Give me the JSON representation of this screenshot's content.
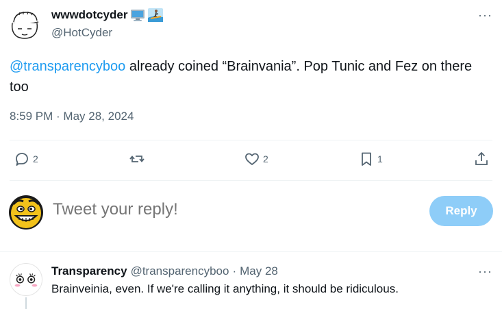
{
  "tweet": {
    "author": {
      "display_name": "wwwdotcyder",
      "emojis": [
        "desktop-computer-emoji",
        "surfer-emoji"
      ],
      "handle": "@HotCyder",
      "avatar_icon": "sketch-face-avatar"
    },
    "more_label": "···",
    "text": {
      "mention": "@transparencyboo",
      "body_1": " already coined “Brainvania”. Pop Tunic and Fez on there too"
    },
    "timestamp": "8:59 PM · May 28, 2024",
    "actions": {
      "reply": {
        "icon": "reply-icon",
        "count": "2"
      },
      "retweet": {
        "icon": "retweet-icon",
        "count": ""
      },
      "like": {
        "icon": "heart-icon",
        "count": "2"
      },
      "bookmark": {
        "icon": "bookmark-icon",
        "count": "1"
      },
      "share": {
        "icon": "share-icon"
      }
    }
  },
  "composer": {
    "avatar_icon": "grinning-yellow-face-avatar",
    "placeholder": "Tweet your reply!",
    "button_label": "Reply"
  },
  "reply": {
    "author_name": "Transparency",
    "handle": "@transparencyboo",
    "separator": "·",
    "date": "May 28",
    "text": "Brainveinia, even. If we're calling it anything, it should be ridiculous.",
    "avatar_icon": "cartoon-eyes-avatar",
    "more_label": "···"
  },
  "colors": {
    "accent": "#1d9bf0",
    "muted": "#536471",
    "reply_button_bg": "#8ecdf8"
  }
}
